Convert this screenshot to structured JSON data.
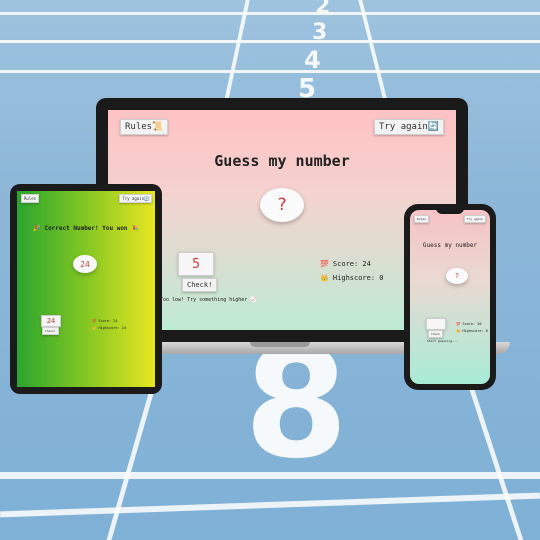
{
  "laptop": {
    "rules_label": "Rules📜",
    "try_again_label": "Try again🔄",
    "title": "Guess my number",
    "secret_symbol": "?",
    "guess_value": "5",
    "check_label": "Check!",
    "message": "Too low! Try something higher 📈",
    "score_text": "💯 Score: 24",
    "highscore_text": "👑 Highscore: 0"
  },
  "tablet": {
    "rules_label": "Rules",
    "try_again_label": "Try again🔄",
    "title": "🎉 Correct Number! You won 🎉",
    "secret_value": "24",
    "guess_value": "24",
    "check_label": "Check!",
    "score_text": "💯 Score: 24",
    "highscore_text": "👑 Highscore: 24"
  },
  "phone": {
    "rules_label": "Rules",
    "try_again_label": "Try again",
    "title": "Guess my number",
    "secret_symbol": "?",
    "check_label": "Check",
    "message": "Start guessing...",
    "score_text": "💯 Score: 20",
    "highscore_text": "👑 Highscore: 0"
  },
  "background": {
    "lane_numbers": [
      "2",
      "3",
      "4",
      "5",
      "8"
    ]
  }
}
